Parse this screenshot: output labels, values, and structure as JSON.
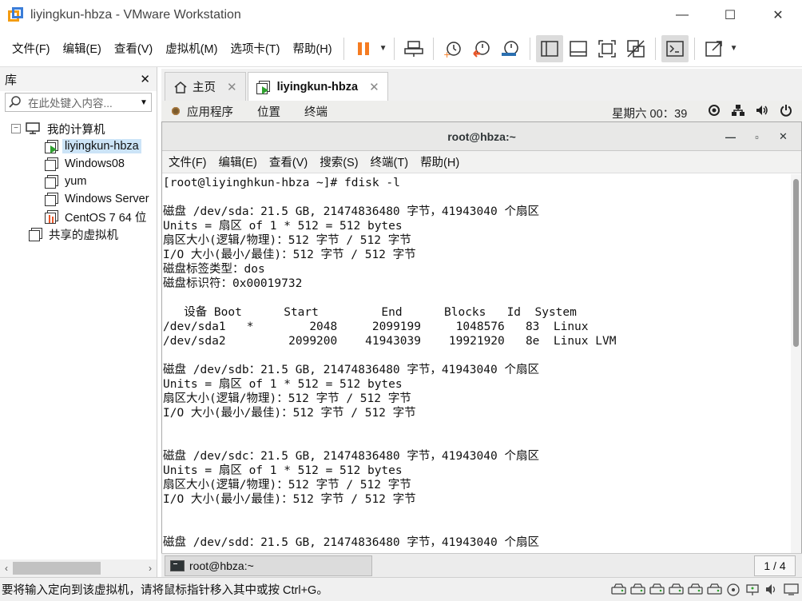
{
  "window": {
    "title": "liyingkun-hbza - VMware Workstation",
    "minimize_glyph": "—",
    "maximize_glyph": "☐",
    "close_glyph": "✕"
  },
  "menu": [
    "文件(F)",
    "编辑(E)",
    "查看(V)",
    "虚拟机(M)",
    "选项卡(T)",
    "帮助(H)"
  ],
  "toolbar": {
    "icons": [
      "pause-icon",
      "send-ctrl-alt-del-icon",
      "snapshot-take-icon",
      "snapshot-revert-icon",
      "snapshot-manager-icon",
      "view-library-icon",
      "view-thumbnail-icon",
      "full-screen-icon",
      "unity-icon",
      "console-icon",
      "stretch-icon"
    ],
    "pause_color": "#f57c22"
  },
  "library": {
    "title": "库",
    "close_glyph": "✕",
    "search_placeholder": "在此处键入内容...",
    "tree": {
      "root": "我的计算机",
      "expander": "−",
      "vms": [
        {
          "label": "liyingkun-hbza",
          "selected": true,
          "running": true
        },
        {
          "label": "Windows08",
          "selected": false
        },
        {
          "label": "yum",
          "selected": false
        },
        {
          "label": "Windows Server",
          "selected": false
        },
        {
          "label": "CentOS 7 64 位",
          "selected": false,
          "centos": true
        }
      ],
      "shared": "共享的虚拟机"
    }
  },
  "tabs": [
    {
      "label": "主页",
      "active": false
    },
    {
      "label": "liyingkun-hbza",
      "active": true
    }
  ],
  "tab_close_glyph": "✕",
  "guest": {
    "top_bar": {
      "applications": "应用程序",
      "places": "位置",
      "terminal": "终端",
      "clock": "星期六 00：39"
    },
    "terminal_window": {
      "title": "root@hbza:~",
      "menu": [
        "文件(F)",
        "编辑(E)",
        "查看(V)",
        "搜索(S)",
        "终端(T)",
        "帮助(H)"
      ],
      "lines": [
        "[root@liyinghkun-hbza ~]# fdisk -l",
        "",
        "磁盘 /dev/sda：21.5 GB, 21474836480 字节，41943040 个扇区",
        "Units = 扇区 of 1 * 512 = 512 bytes",
        "扇区大小(逻辑/物理)：512 字节 / 512 字节",
        "I/O 大小(最小/最佳)：512 字节 / 512 字节",
        "磁盘标签类型：dos",
        "磁盘标识符：0x00019732",
        "",
        "   设备 Boot      Start         End      Blocks   Id  System",
        "/dev/sda1   *        2048     2099199     1048576   83  Linux",
        "/dev/sda2         2099200    41943039    19921920   8e  Linux LVM",
        "",
        "磁盘 /dev/sdb：21.5 GB, 21474836480 字节，41943040 个扇区",
        "Units = 扇区 of 1 * 512 = 512 bytes",
        "扇区大小(逻辑/物理)：512 字节 / 512 字节",
        "I/O 大小(最小/最佳)：512 字节 / 512 字节",
        "",
        "",
        "磁盘 /dev/sdc：21.5 GB, 21474836480 字节，41943040 个扇区",
        "Units = 扇区 of 1 * 512 = 512 bytes",
        "扇区大小(逻辑/物理)：512 字节 / 512 字节",
        "I/O 大小(最小/最佳)：512 字节 / 512 字节",
        "",
        "",
        "磁盘 /dev/sdd：21.5 GB, 21474836480 字节，41943040 个扇区"
      ]
    },
    "taskbar": {
      "item": "root@hbza:~",
      "pager": "1 / 4"
    }
  },
  "status": {
    "message": "要将输入定向到该虚拟机，请将鼠标指针移入其中或按 Ctrl+G。",
    "icons": [
      "hdd-icon",
      "hdd-icon",
      "hdd-icon",
      "hdd-icon",
      "hdd-icon",
      "hdd-icon",
      "cdrom-icon",
      "network-icon",
      "sound-icon",
      "display-icon"
    ]
  }
}
